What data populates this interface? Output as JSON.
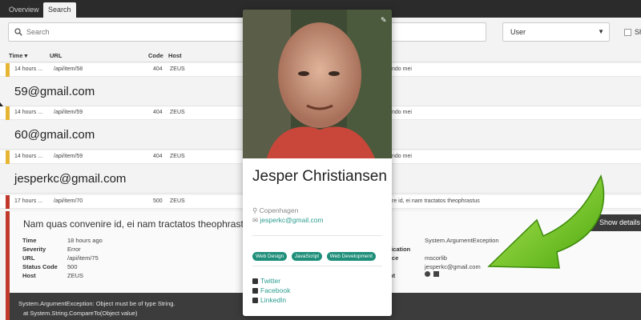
{
  "tabs": [
    {
      "label": "Overview"
    },
    {
      "label": "Search"
    }
  ],
  "search": {
    "placeholder": "Search",
    "select_value": "User",
    "checkbox_label": "Sh"
  },
  "columns": {
    "time": "Time",
    "url": "URL",
    "code": "Code",
    "host": "Host"
  },
  "rows": [
    {
      "time": "14 hours ...",
      "url": "/api/item/58",
      "code": "404",
      "host": "ZEUS",
      "message": "ndo mei",
      "color": "#e6b533"
    },
    {
      "time": "14 hours ...",
      "url": "/api/item/59",
      "code": "404",
      "host": "ZEUS",
      "message": "ndo mei",
      "color": "#e6b533"
    },
    {
      "time": "14 hours ...",
      "url": "/api/item/59",
      "code": "404",
      "host": "ZEUS",
      "message": "ndo mei",
      "color": "#e6b533"
    },
    {
      "time": "17 hours ...",
      "url": "/api/item/70",
      "code": "500",
      "host": "ZEUS",
      "message": "re id, ei nam tractatos theophrastus",
      "color": "#c0392b"
    }
  ],
  "emails": [
    "59@gmail.com",
    "60@gmail.com",
    "jesperkc@gmail.com"
  ],
  "detail": {
    "title": "Nam quas convenire id, ei nam tractatos theophrastus",
    "show_details_label": "Show details",
    "fields": [
      {
        "key": "Time",
        "value": "18 hours ago"
      },
      {
        "key": "Severity",
        "value": "Error"
      },
      {
        "key": "URL",
        "value": "/api/item/75"
      },
      {
        "key": "Status Code",
        "value": "500"
      },
      {
        "key": "Host",
        "value": "ZEUS"
      }
    ],
    "right_fields": [
      {
        "key": "r",
        "value": "System.ArgumentException"
      },
      {
        "key": "lication",
        "value": ""
      },
      {
        "key": "rce",
        "value": "mscorlib"
      },
      {
        "key": "",
        "value": "jesperkc@gmail.com"
      },
      {
        "key": "nt",
        "value": ""
      }
    ]
  },
  "stack": {
    "line1": "System.ArgumentException: Object must be of type String.",
    "line2": "at System.String.CompareTo(Object value)"
  },
  "card": {
    "name": "Jesper Christiansen",
    "location": "Copenhagen",
    "email": "jesperkc@gmail.com",
    "tags": [
      "Web Design",
      "JavaScript",
      "Web Development"
    ],
    "social": [
      "Twitter",
      "Facebook",
      "LinkedIn"
    ]
  },
  "colors": {
    "accent": "#1f8f7a",
    "warning": "#e6b533",
    "error": "#c0392b",
    "arrow": "#6cc51a"
  }
}
